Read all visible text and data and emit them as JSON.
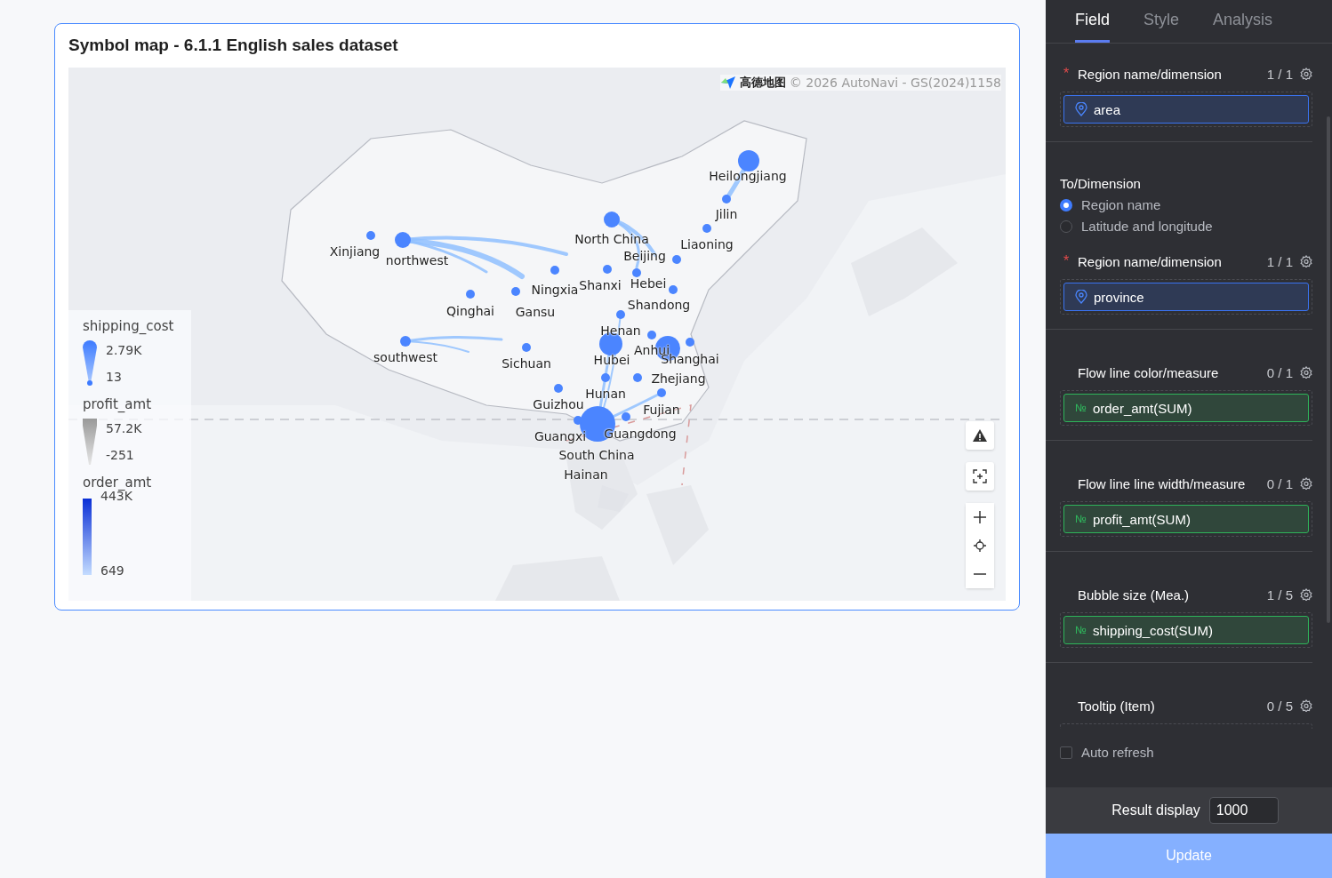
{
  "chart": {
    "title": "Symbol map - 6.1.1 English sales dataset",
    "attribution": {
      "logo": "高德地图",
      "text": "© 2026 AutoNavi - GS(2024)1158"
    },
    "region_labels": [
      "Heilongjiang",
      "Jilin",
      "Xinjiang",
      "northwest",
      "North China",
      "Beijing",
      "Liaoning",
      "Ningxia",
      "Shanxi",
      "Hebei",
      "Qinghai",
      "Gansu",
      "Shandong",
      "Henan",
      "southwest",
      "Sichuan",
      "Hubei",
      "Anhui",
      "Shanghai",
      "Zhejiang",
      "Guizhou",
      "Hunan",
      "Fujian",
      "Guangxi",
      "Guangdong",
      "South China",
      "Hainan"
    ],
    "legends": [
      {
        "kind": "size",
        "title": "shipping_cost",
        "max": "2.79K",
        "min": "13"
      },
      {
        "kind": "width",
        "title": "profit_amt",
        "max": "57.2K",
        "min": "-251"
      },
      {
        "kind": "color",
        "title": "order_amt",
        "max": "443K",
        "min": "649"
      }
    ]
  },
  "panel": {
    "tabs": [
      {
        "label": "Field",
        "selected": true
      },
      {
        "label": "Style",
        "selected": false
      },
      {
        "label": "Analysis",
        "selected": false
      }
    ],
    "sections": [
      {
        "required_mark": "*",
        "title": "Region name/dimension",
        "count": "1 / 1",
        "fields": [
          {
            "kind": "dimension",
            "name": "area"
          }
        ]
      },
      {
        "heading": "To/Dimension",
        "options": [
          {
            "label": "Region name",
            "selected": true
          },
          {
            "label": "Latitude and longitude",
            "selected": false
          }
        ],
        "required_mark": "*",
        "title": "Region name/dimension",
        "count": "1 / 1",
        "fields": [
          {
            "kind": "dimension",
            "name": "province"
          }
        ]
      },
      {
        "title": "Flow line color/measure",
        "count": "0 / 1",
        "fields": [
          {
            "kind": "measure",
            "glyph": "№",
            "name": "order_amt(SUM)"
          }
        ]
      },
      {
        "title": "Flow line line width/measure",
        "count": "0 / 1",
        "fields": [
          {
            "kind": "measure",
            "glyph": "№",
            "name": "profit_amt(SUM)"
          }
        ]
      },
      {
        "title": "Bubble size (Mea.)",
        "count": "1 / 5",
        "fields": [
          {
            "kind": "measure",
            "glyph": "№",
            "name": "shipping_cost(SUM)"
          }
        ]
      },
      {
        "title": "Tooltip (Item)",
        "count": "0 / 5"
      }
    ],
    "auto_refresh": {
      "label": "Auto refresh",
      "checked": false
    },
    "result_display": {
      "label": "Result display",
      "value": "1000"
    },
    "update_button": "Update"
  }
}
